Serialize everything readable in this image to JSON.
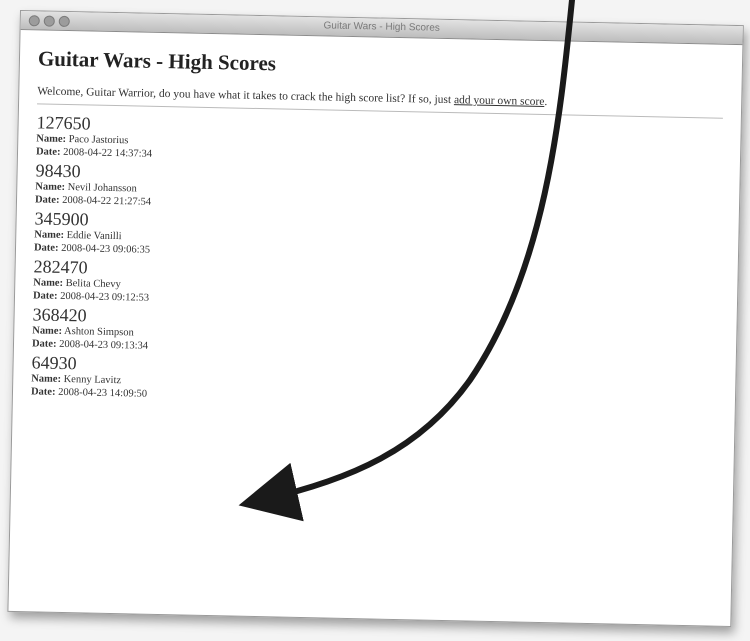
{
  "window": {
    "title": "Guitar Wars - High Scores"
  },
  "page": {
    "heading": "Guitar Wars - High Scores",
    "intro_text": "Welcome, Guitar Warrior, do you have what it takes to crack the high score list? If so, just ",
    "intro_link": "add your own score",
    "intro_end": "."
  },
  "labels": {
    "name": "Name:",
    "date": "Date:"
  },
  "scores": [
    {
      "score": "127650",
      "name": "Paco Jastorius",
      "date": "2008-04-22 14:37:34"
    },
    {
      "score": "98430",
      "name": "Nevil Johansson",
      "date": "2008-04-22 21:27:54"
    },
    {
      "score": "345900",
      "name": "Eddie Vanilli",
      "date": "2008-04-23 09:06:35"
    },
    {
      "score": "282470",
      "name": "Belita Chevy",
      "date": "2008-04-23 09:12:53"
    },
    {
      "score": "368420",
      "name": "Ashton Simpson",
      "date": "2008-04-23 09:13:34"
    },
    {
      "score": "64930",
      "name": "Kenny Lavitz",
      "date": "2008-04-23 14:09:50"
    }
  ]
}
